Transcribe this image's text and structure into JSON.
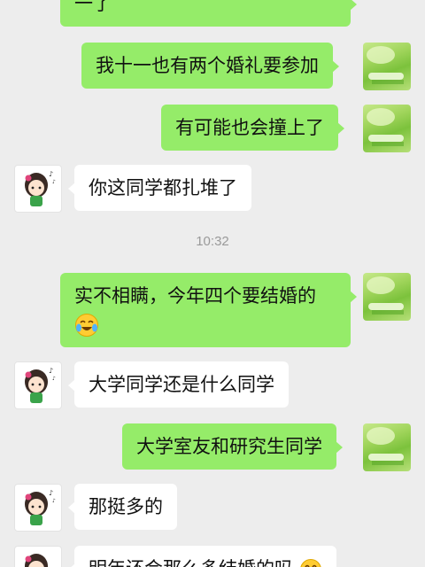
{
  "messages": [
    {
      "from": "me",
      "text": "一了"
    },
    {
      "from": "me",
      "text": "我十一也有两个婚礼要参加"
    },
    {
      "from": "me",
      "text": "有可能也会撞上了"
    },
    {
      "from": "other",
      "text": "你这同学都扎堆了"
    },
    {
      "type": "timestamp",
      "text": "10:32"
    },
    {
      "from": "me",
      "text": "实不相瞒，今年四个要结婚的",
      "emoji": "crying-laughing-emoji"
    },
    {
      "from": "other",
      "text": "大学同学还是什么同学"
    },
    {
      "from": "me",
      "text": "大学室友和研究生同学"
    },
    {
      "from": "other",
      "text": "那挺多的"
    },
    {
      "from": "other",
      "text": "明年还会那么多结婚的吗",
      "emoji": "crying-laughing-emoji"
    }
  ],
  "avatars": {
    "me": "green-nature-avatar",
    "other": "cartoon-girl-avatar"
  },
  "colors": {
    "background": "#ededed",
    "my_bubble": "#95ec69",
    "other_bubble": "#ffffff",
    "timestamp_text": "#9a9a9a"
  }
}
